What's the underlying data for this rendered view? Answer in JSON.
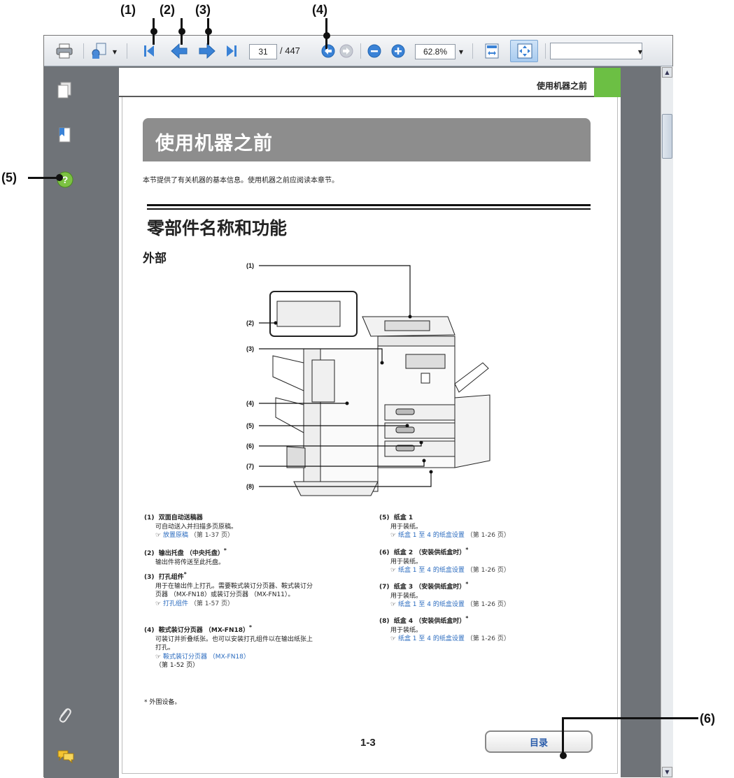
{
  "callouts": {
    "c1": "(1)",
    "c2": "(2)",
    "c3": "(3)",
    "c4": "(4)",
    "c5": "(5)",
    "c6": "(6)"
  },
  "toolbar": {
    "page_current": "31",
    "page_total": "/ 447",
    "zoom": "62.8%",
    "search_value": ""
  },
  "page": {
    "header": "使用机器之前",
    "banner_title": "使用机器之前",
    "intro": "本节提供了有关机器的基本信息。使用机器之前应阅读本章节。",
    "section_title": "零部件名称和功能",
    "subsection_title": "外部",
    "diagram_labels": [
      "(1)",
      "(2)",
      "(3)",
      "(4)",
      "(5)",
      "(6)",
      "(7)",
      "(8)"
    ],
    "items_left": [
      {
        "num": "(1)",
        "title": "双面自动送稿器",
        "sup": "",
        "body": [
          "可自动送入并扫描多页原稿。"
        ],
        "link": "放置原稿",
        "ref": "（第 1-37 页）"
      },
      {
        "num": "(2)",
        "title": "输出托盘 （中央托盘）",
        "sup": "*",
        "body": [
          "输出件将传送至此托盘。"
        ],
        "link": "",
        "ref": ""
      },
      {
        "num": "(3)",
        "title": "打孔组件",
        "sup": "*",
        "body": [
          "用于在输出件上打孔。需要鞍式装订分页器、鞍式装订分",
          "页器 （MX-FN18）或装订分页器 （MX-FN11）。"
        ],
        "link": "打孔组件",
        "ref": "（第 1-57 页）"
      },
      {
        "num": "(4)",
        "title": "鞍式装订分页器 （MX-FN18）",
        "sup": "*",
        "body": [
          "可装订并折叠纸张。也可以安装打孔组件以在输出纸张上",
          "打孔。"
        ],
        "link": "鞍式装订分页器 （MX-FN18）",
        "ref": "（第 1-52 页）"
      }
    ],
    "items_right": [
      {
        "num": "(5)",
        "title": "纸盒 1",
        "sup": "",
        "body": [
          "用于装纸。"
        ],
        "link": "纸盒 1 至 4 的纸盒设置",
        "ref": "（第 1-26 页）"
      },
      {
        "num": "(6)",
        "title": "纸盒 2 （安装供纸盒时）",
        "sup": "*",
        "body": [
          "用于装纸。"
        ],
        "link": "纸盒 1 至 4 的纸盒设置",
        "ref": "（第 1-26 页）"
      },
      {
        "num": "(7)",
        "title": "纸盒 3 （安装供纸盒时）",
        "sup": "*",
        "body": [
          "用于装纸。"
        ],
        "link": "纸盒 1 至 4 的纸盒设置",
        "ref": "（第 1-26 页）"
      },
      {
        "num": "(8)",
        "title": "纸盒 4 （安装供纸盒时）",
        "sup": "*",
        "body": [
          "用于装纸。"
        ],
        "link": "纸盒 1 至 4 的纸盒设置",
        "ref": "（第 1-26 页）"
      }
    ],
    "footnote": "* 外围设备。",
    "page_number": "1-3",
    "toc_button": "目录"
  },
  "colors": {
    "accent_green": "#6cbf44",
    "link_blue": "#2a6bbf",
    "banner_gray": "#8d8d8d"
  }
}
